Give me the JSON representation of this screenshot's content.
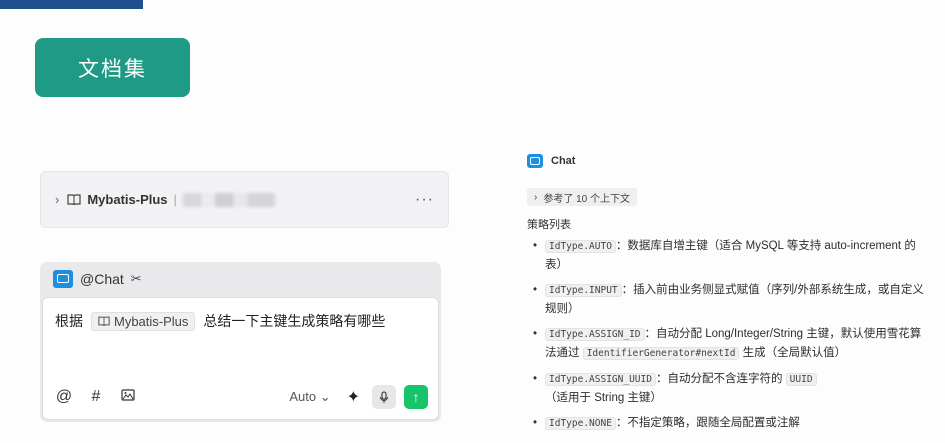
{
  "badge": {
    "title": "文档集"
  },
  "kb_card": {
    "name": "Mybatis-Plus",
    "separator": "|",
    "more": "···"
  },
  "chat": {
    "header": "@Chat",
    "prompt_prefix": "根据",
    "ref_chip": "Mybatis-Plus",
    "prompt_suffix": "总结一下主键生成策略有哪些",
    "toolbar": {
      "at": "@",
      "hash": "#",
      "model": "Auto"
    }
  },
  "answer": {
    "sender": "Chat",
    "ref_pill": "参考了 10 个上下文",
    "section_title": "策略列表",
    "items": [
      {
        "code": "IdType.AUTO",
        "text": "：数据库自增主键（适合 MySQL 等支持 auto-increment 的表）"
      },
      {
        "code": "IdType.INPUT",
        "text": "：插入前由业务侧显式赋值（序列/外部系统生成，或自定义规则）"
      },
      {
        "code": "IdType.ASSIGN_ID",
        "text_a": "：自动分配 Long/Integer/String 主键，默认使用雪花算法通过",
        "code2": "IdentifierGenerator#nextId",
        "text_b": "生成（全局默认值）"
      },
      {
        "code": "IdType.ASSIGN_UUID",
        "text_a": "：自动分配不含连字符的",
        "code2": "UUID",
        "text_b": "（适用于 String 主键）"
      },
      {
        "code": "IdType.NONE",
        "text": "：不指定策略，跟随全局配置或注解"
      }
    ]
  }
}
